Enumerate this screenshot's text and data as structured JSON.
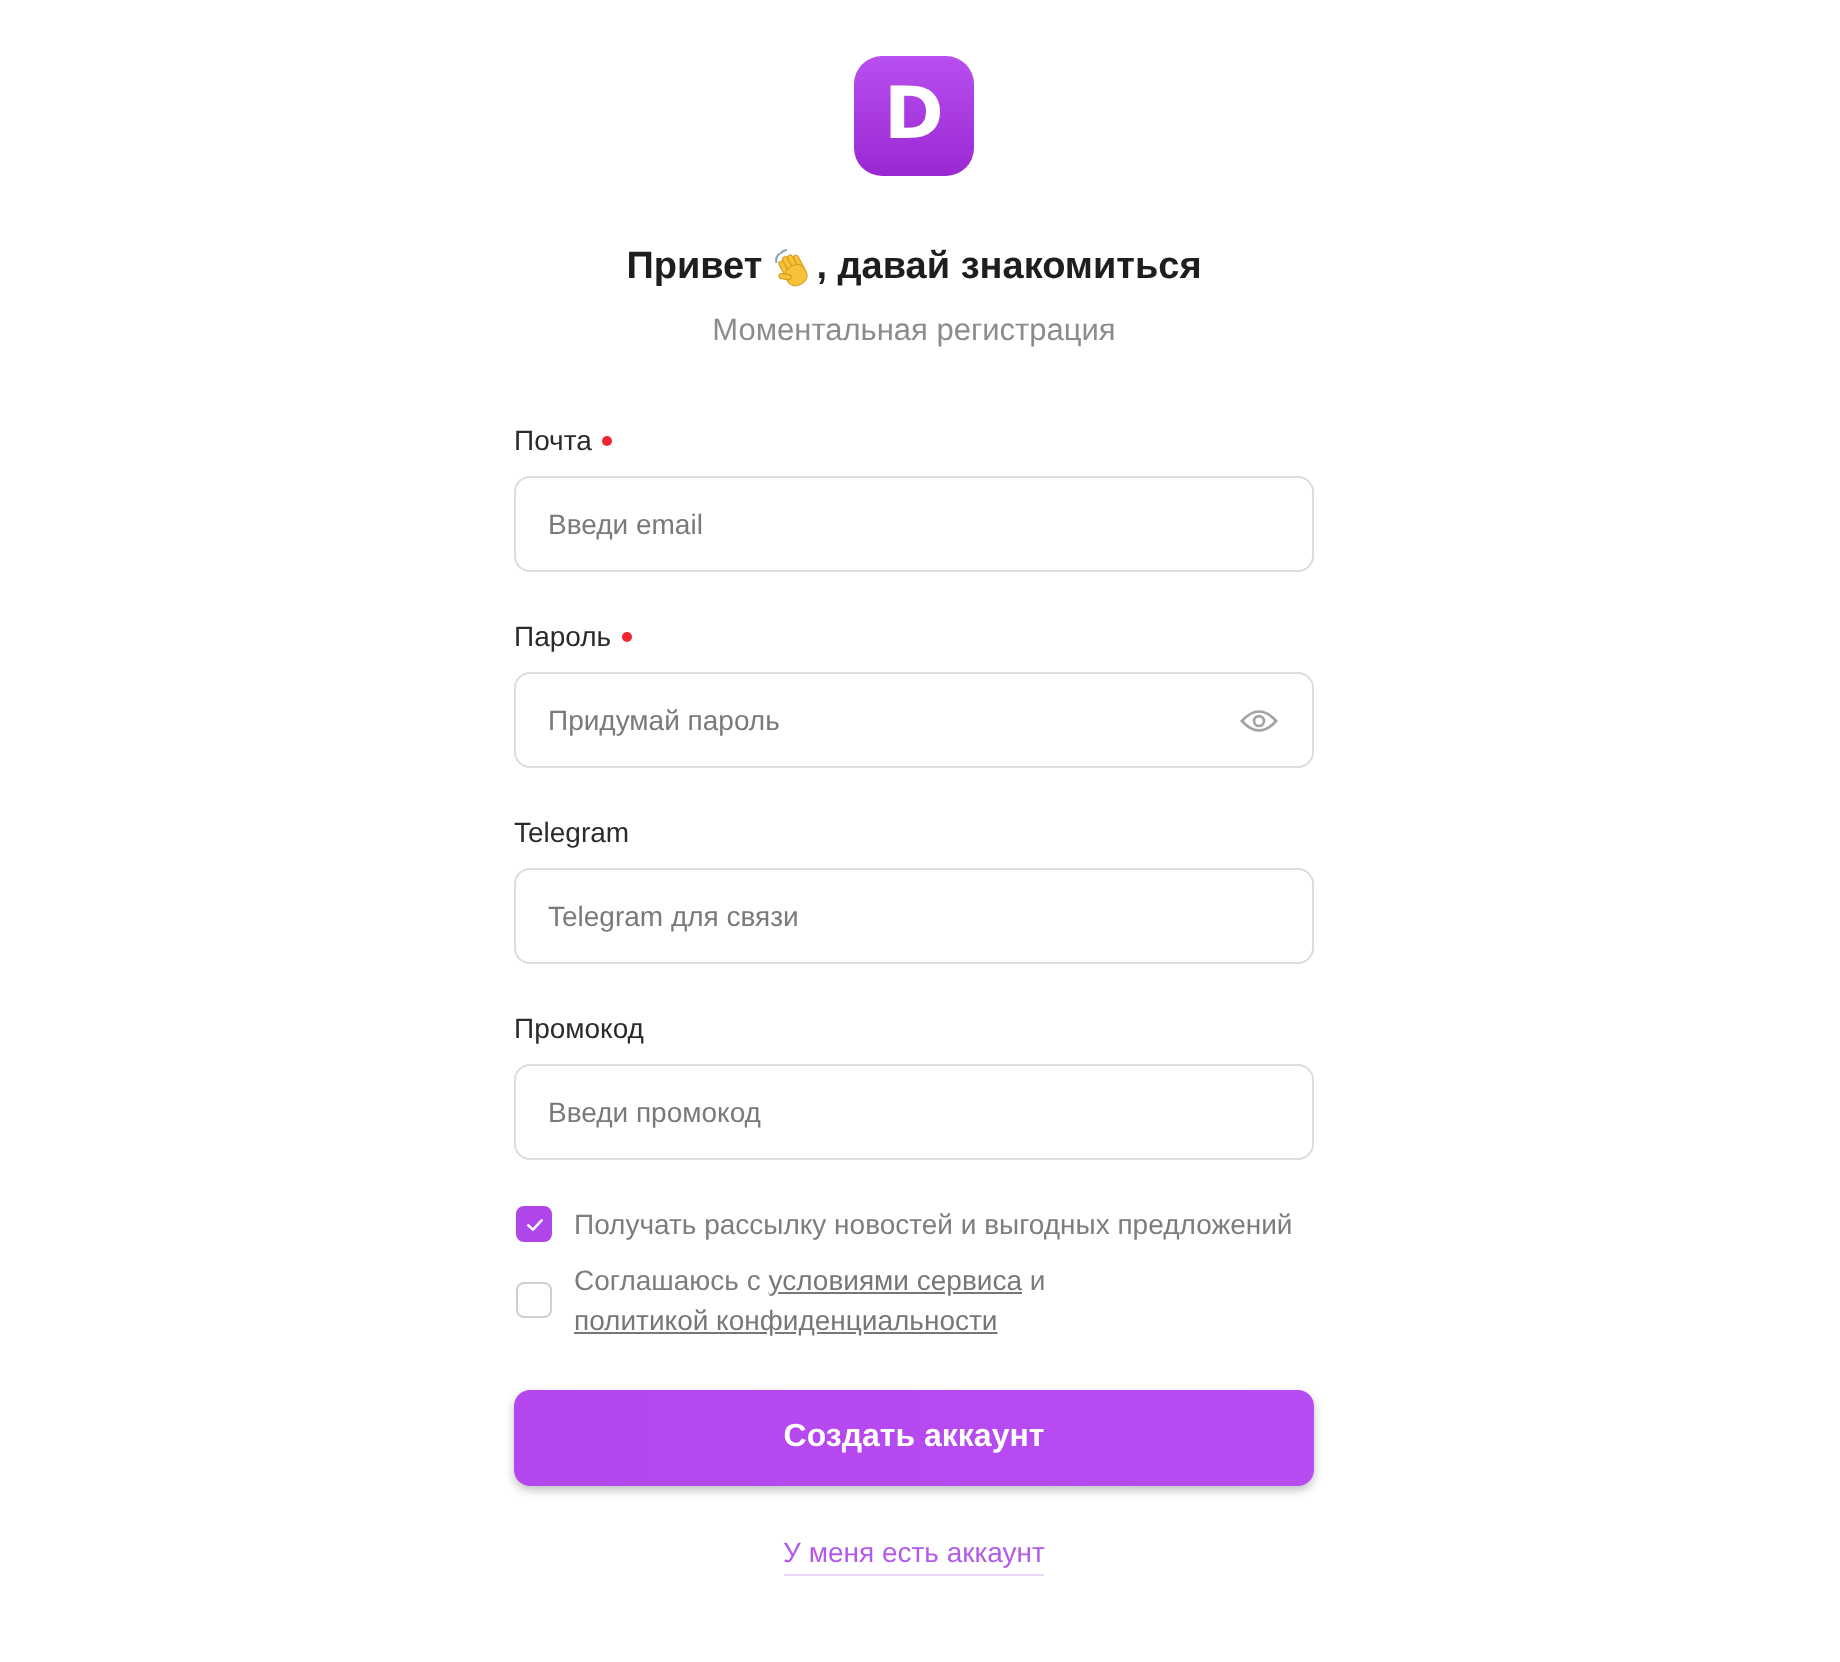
{
  "logo": {
    "letter": "D"
  },
  "heading": {
    "before_emoji": "Привет",
    "after_emoji": ", давай знакомиться"
  },
  "subtitle": "Моментальная регистрация",
  "fields": [
    {
      "label": "Почта",
      "required": true,
      "kind": "text",
      "placeholder": "Введи email"
    },
    {
      "label": "Пароль",
      "required": true,
      "kind": "password",
      "placeholder": "Придумай пароль"
    },
    {
      "label": "Telegram",
      "required": false,
      "kind": "text",
      "placeholder": "Telegram для связи"
    },
    {
      "label": "Промокод",
      "required": false,
      "kind": "text",
      "placeholder": "Введи промокод"
    }
  ],
  "checkboxes": [
    {
      "checked": true,
      "parts": [
        {
          "kind": "text",
          "text": "Получать рассылку новостей и выгодных предложений"
        }
      ]
    },
    {
      "checked": false,
      "parts": [
        {
          "kind": "text",
          "text": "Соглашаюсь с "
        },
        {
          "kind": "link",
          "text": "условиями сервиса"
        },
        {
          "kind": "text",
          "text": " и "
        },
        {
          "kind": "link",
          "text": "политикой конфиденциальности"
        }
      ]
    }
  ],
  "submit_button": "Создать аккаунт",
  "login_link": "У меня есть аккаунт"
}
